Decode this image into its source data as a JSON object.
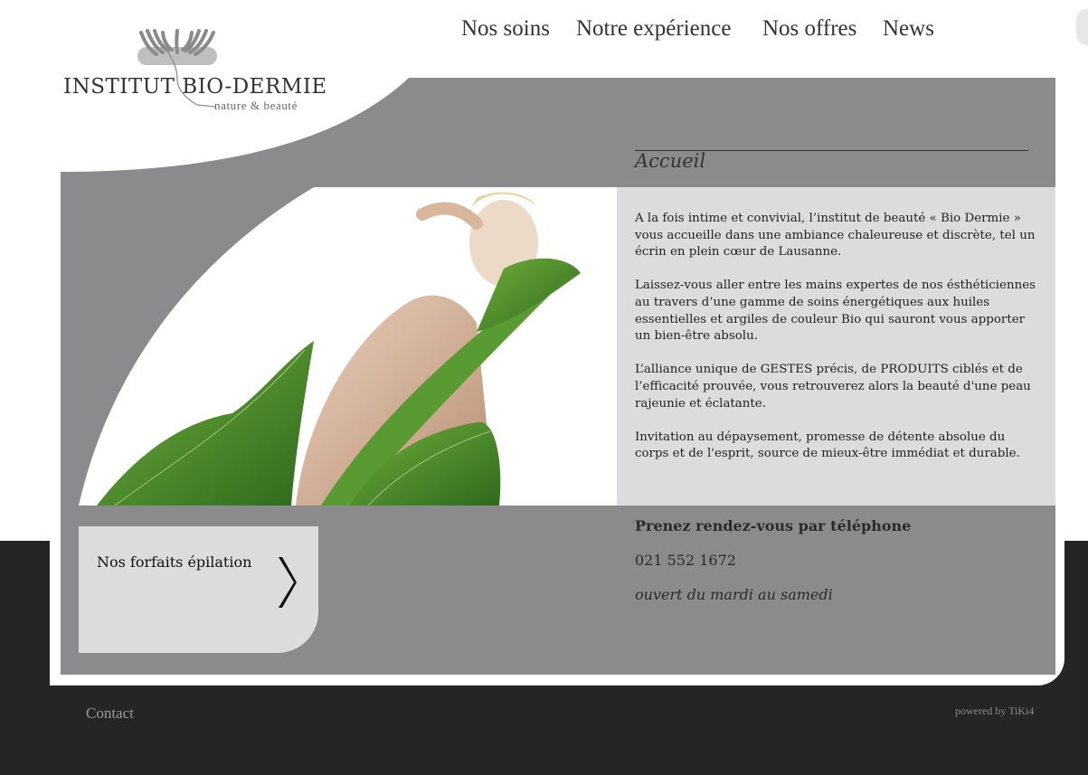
{
  "site": {
    "logo_title": "INSTITUT BIO-DERMIE",
    "logo_subtitle": "nature & beauté",
    "logo_icon": "leaf-fan-logo-icon"
  },
  "nav": {
    "items": [
      {
        "label": "Nos soins"
      },
      {
        "label": "Notre expérience"
      },
      {
        "label": "Nos offres"
      },
      {
        "label": "News"
      }
    ]
  },
  "page": {
    "heading": "Accueil",
    "paragraphs": [
      "A la fois intime et convivial, l’institut de beauté « Bio Dermie » vous accueille dans une ambiance chaleureuse et discrète, tel un écrin en plein cœur de Lausanne.",
      "Laissez-vous aller entre les mains expertes de nos ésthéticiennes au travers d’une gamme de soins énergétiques aux huiles essentielles et argiles de couleur Bio qui sauront vous apporter un bien-être absolu.",
      "L’alliance unique de GESTES précis, de PRODUITS ciblés et de l’efficacité prouvée, vous retrouverez alors la beauté d'une peau rajeunie et éclatante.",
      "Invitation au dépaysement, promesse de détente absolue du corps et de l'esprit, source de mieux-être immédiat et durable."
    ]
  },
  "promo": {
    "label": "Nos forfaits épilation",
    "icon": "chevron-right-icon"
  },
  "appointment": {
    "title": "Prenez rendez-vous par téléphone",
    "phone": "021 552 1672",
    "hours": "ouvert du mardi au samedi"
  },
  "footer": {
    "contact_label": "Contact",
    "powered_by": "powered by TiKi4"
  },
  "colors": {
    "panel_grey": "#8b8b8d",
    "light_grey": "#dcdcde",
    "footer_dark": "#252525",
    "text_dark": "#333333"
  }
}
